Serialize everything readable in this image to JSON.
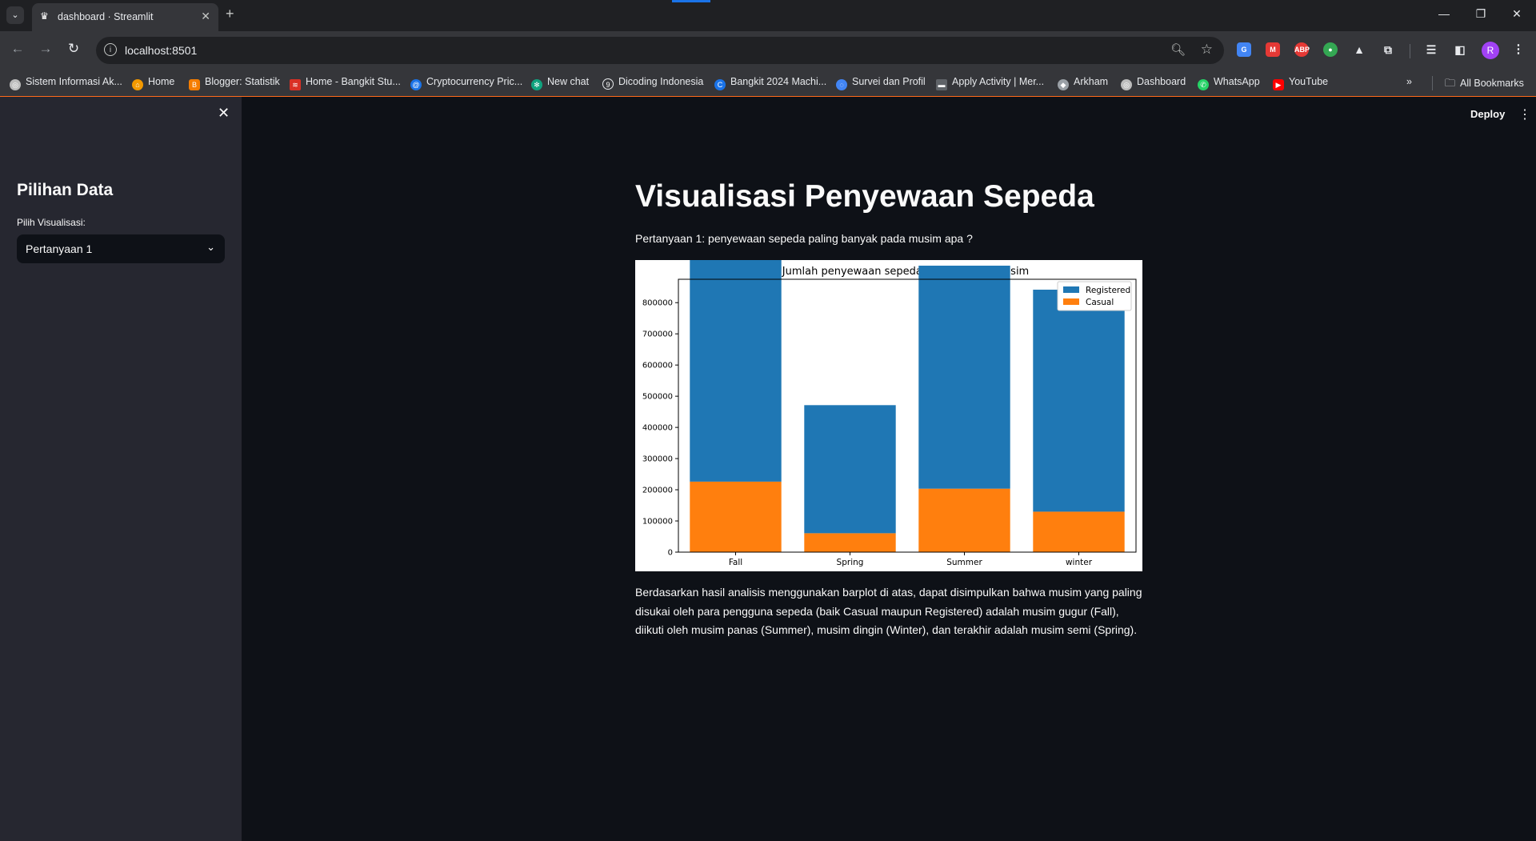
{
  "browser": {
    "tab_title": "dashboard · Streamlit",
    "url": "localhost:8501",
    "bookmarks": [
      {
        "label": "Sistem Informasi Ak..."
      },
      {
        "label": "Home"
      },
      {
        "label": "Blogger: Statistik"
      },
      {
        "label": "Home - Bangkit Stu..."
      },
      {
        "label": "Cryptocurrency Pric..."
      },
      {
        "label": "New chat"
      },
      {
        "label": "Dicoding Indonesia"
      },
      {
        "label": "Bangkit 2024 Machi..."
      },
      {
        "label": "Survei dan Profil"
      },
      {
        "label": "Apply Activity | Mer..."
      },
      {
        "label": "Arkham"
      },
      {
        "label": "Dashboard"
      },
      {
        "label": "WhatsApp"
      },
      {
        "label": "YouTube"
      }
    ],
    "all_bookmarks": "All Bookmarks",
    "avatar_letter": "R"
  },
  "header": {
    "deploy_label": "Deploy"
  },
  "sidebar": {
    "title": "Pilihan Data",
    "select_label": "Pilih Visualisasi:",
    "select_value": "Pertanyaan 1"
  },
  "main": {
    "title": "Visualisasi Penyewaan Sepeda",
    "question": "Pertanyaan 1: penyewaan sepeda paling banyak pada musim apa ?",
    "analysis": "Berdasarkan hasil analisis menggunakan barplot di atas, dapat disimpulkan bahwa musim yang paling disukai oleh para pengguna sepeda (baik Casual maupun Registered) adalah musim gugur (Fall), diikuti oleh musim panas (Summer), musim dingin (Winter), dan terakhir adalah musim semi (Spring)."
  },
  "chart_data": {
    "type": "bar",
    "stacked": true,
    "title": "Jumlah penyewaan sepeda berdasarkan musim",
    "xlabel": "",
    "ylabel": "",
    "categories": [
      "Fall",
      "Spring",
      "Summer",
      "winter"
    ],
    "series": [
      {
        "name": "Registered",
        "color": "#1f77b4",
        "values": [
          835038,
          410726,
          715067,
          711831
        ]
      },
      {
        "name": "Casual",
        "color": "#ff7f0e",
        "values": [
          226091,
          60622,
          203522,
          129782
        ]
      }
    ],
    "ylim": [
      0,
      875000
    ],
    "yticks": [
      "0",
      "100000",
      "200000",
      "300000",
      "400000",
      "500000",
      "600000",
      "700000",
      "800000"
    ],
    "legend": "top-right"
  }
}
